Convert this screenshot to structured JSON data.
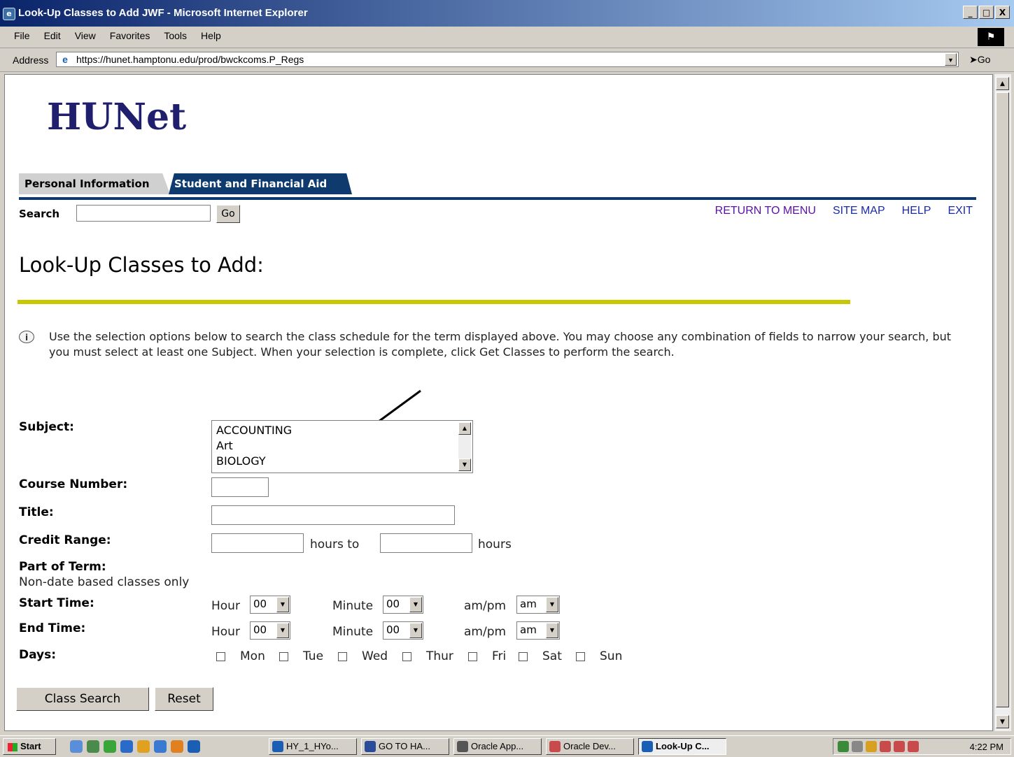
{
  "window": {
    "title": "Look-Up Classes to Add JWF - Microsoft Internet Explorer",
    "buttons": [
      "_",
      "□",
      "X"
    ]
  },
  "menu": [
    "File",
    "Edit",
    "View",
    "Favorites",
    "Tools",
    "Help"
  ],
  "address": {
    "label": "Address",
    "url": "https://hunet.hamptonu.edu/prod/bwckcoms.P_Regs",
    "go_label": "Go"
  },
  "page": {
    "logo": "HUNet",
    "tabs": [
      "Personal Information",
      "Student and Financial Aid"
    ],
    "search_label": "Search",
    "search_value": "",
    "search_go": "Go",
    "top_links": [
      "RETURN TO MENU",
      "SITE MAP",
      "HELP",
      "EXIT"
    ],
    "title": "Look-Up Classes to Add:",
    "info": "Use the selection options below to search the class schedule for the term displayed above. You may choose any combination of fields to narrow your search, but you must select at least one Subject. When your selection is complete, click Get Classes to perform the search.",
    "form": {
      "subject_label": "Subject:",
      "subjects": [
        "ACCOUNTING",
        "Art",
        "BIOLOGY"
      ],
      "course_number_label": "Course Number:",
      "title_label": "Title:",
      "credit_range_label": "Credit Range:",
      "hours_to": "hours to",
      "hours": "hours",
      "part_of_term_label": "Part of Term:",
      "non_date": "Non-date based classes only",
      "start_time_label": "Start Time:",
      "end_time_label": "End Time:",
      "hour_label": "Hour",
      "minute_label": "Minute",
      "ampm_label": "am/pm",
      "hour_value": "00",
      "minute_value": "00",
      "ampm_value": "am",
      "days_label": "Days:",
      "days": [
        "Mon",
        "Tue",
        "Wed",
        "Thur",
        "Fri",
        "Sat",
        "Sun"
      ],
      "class_search": "Class Search",
      "reset": "Reset"
    }
  },
  "taskbar": {
    "start": "Start",
    "tasks": [
      "HY_1_HYo...",
      "GO TO HA...",
      "Oracle App...",
      "Oracle Dev...",
      "Look-Up C..."
    ],
    "clock": "4:22 PM"
  }
}
